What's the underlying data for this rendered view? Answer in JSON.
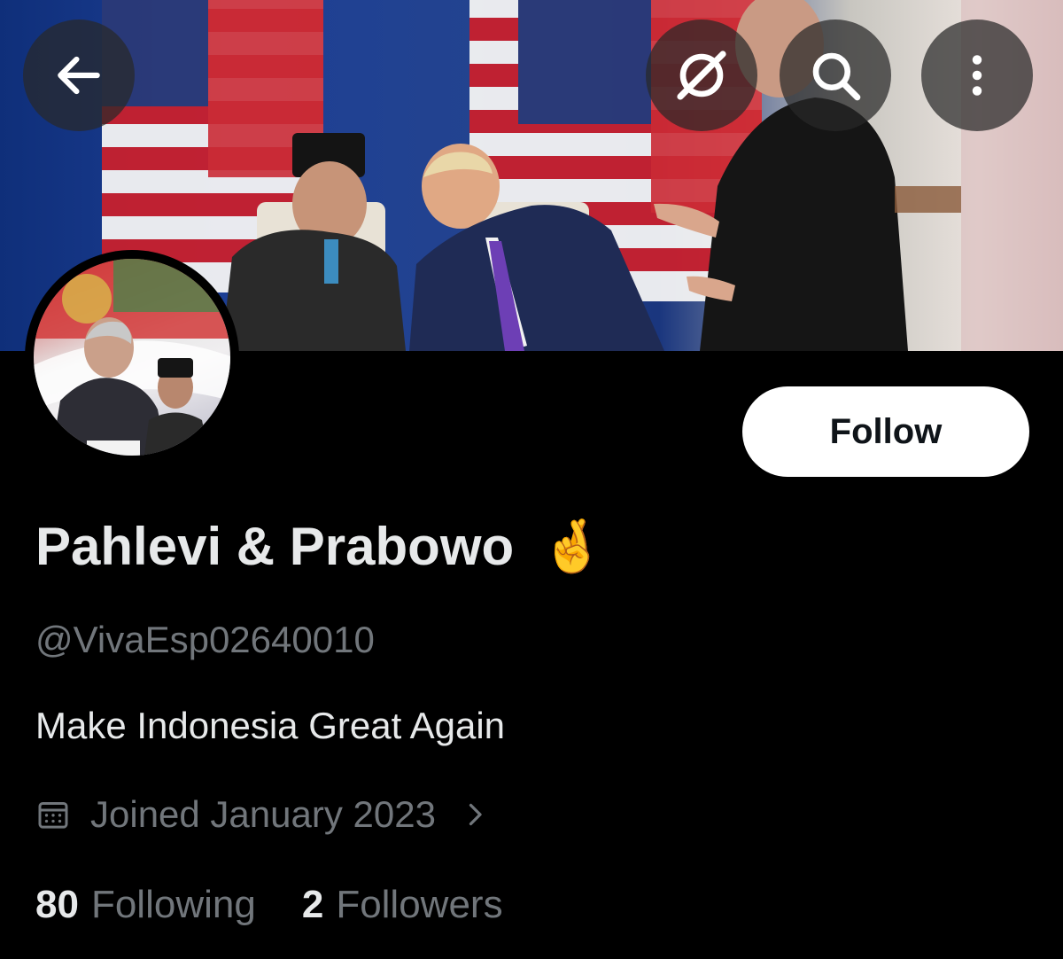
{
  "header": {
    "back_icon": "arrow-left-icon",
    "grok_icon": "grok-icon",
    "search_icon": "search-icon",
    "more_icon": "more-vertical-icon"
  },
  "profile": {
    "display_name": "Pahlevi & Prabowo",
    "name_emoji": "🤞",
    "handle": "@VivaEsp02640010",
    "bio": "Make Indonesia Great Again",
    "joined": "Joined January 2023",
    "follow_label": "Follow",
    "following_count": "80",
    "following_label": "Following",
    "followers_count": "2",
    "followers_label": "Followers"
  },
  "colors": {
    "background": "#000000",
    "text_primary": "#e7e9ea",
    "text_secondary": "#71767b",
    "follow_bg": "#ffffff"
  }
}
